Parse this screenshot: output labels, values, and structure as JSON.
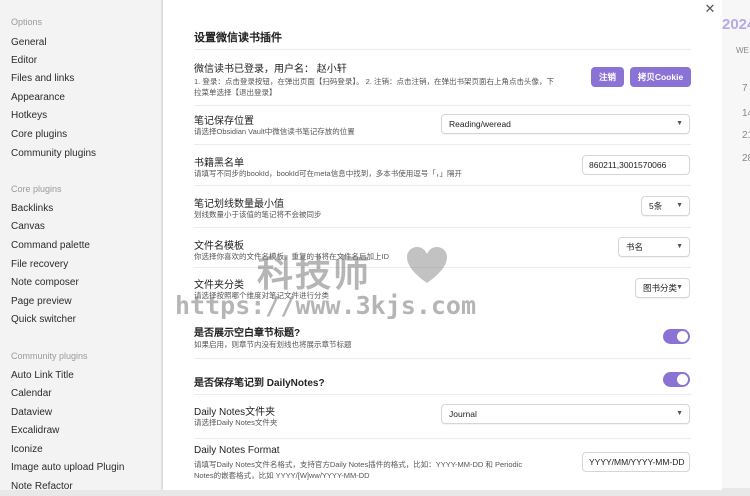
{
  "sidebar": {
    "options_title": "Options",
    "options": [
      "General",
      "Editor",
      "Files and links",
      "Appearance",
      "Hotkeys",
      "Core plugins",
      "Community plugins"
    ],
    "core_title": "Core plugins",
    "core": [
      "Backlinks",
      "Canvas",
      "Command palette",
      "File recovery",
      "Note composer",
      "Page preview",
      "Quick switcher"
    ],
    "community_title": "Community plugins",
    "community": [
      "Auto Link Title",
      "Calendar",
      "Dataview",
      "Excalidraw",
      "Iconize",
      "Image auto upload Plugin",
      "Note Refactor"
    ]
  },
  "main": {
    "close_icon": "✕",
    "title": "设置微信读书插件",
    "login": {
      "name": "微信读书已登录，用户名：  赵小轩",
      "desc1": "1. 登录：点击登录按钮，在弹出页面【扫码登录】。 2. 注销：点击注销，在弹出书架页面右上角点击头像，下",
      "desc2": "拉菜单选择【退出登录】",
      "logout_label": "注销",
      "copy_cookie_label": "拷贝Cookie"
    },
    "save_location": {
      "name": "笔记保存位置",
      "desc": "请选择Obsidian Vault中微信读书笔记存放的位置",
      "value": "Reading/weread"
    },
    "blacklist": {
      "name": "书籍黑名单",
      "desc": "请填写不同步的bookId，bookId可在meta信息中找到，多本书使用逗号「，」隔开",
      "value": "860211,3001570066"
    },
    "min_highlights": {
      "name": "笔记划线数量最小值",
      "desc": "划线数量小于该值的笔记将不会被同步",
      "value": "5条"
    },
    "filename_template": {
      "name": "文件名模板",
      "desc": "你选择你喜欢的文件名模板，重复的书将在文件名后加上ID",
      "value": "书名"
    },
    "folder_category": {
      "name": "文件夹分类",
      "desc": "请选择按照哪个维度对笔记文件进行分类",
      "value": "图书分类"
    },
    "empty_chapter": {
      "name": "是否展示空白章节标题?",
      "desc": "如果启用，则章节内没有划线也将展示章节标题"
    },
    "daily_notes": {
      "name": "是否保存笔记到 DailyNotes?"
    },
    "daily_folder": {
      "name": "Daily Notes文件夹",
      "desc": "请选择Daily Notes文件夹",
      "value": "Journal"
    },
    "daily_format": {
      "name": "Daily Notes Format",
      "desc1": "请填写Daily Notes文件名格式，支持官方Daily Notes插件的格式，比如：YYYY-MM-DD 和 Periodic",
      "desc2": "Notes的嵌套格式，比如 YYYY/[W]ww/YYYY-MM-DD",
      "value": "YYYY/MM/YYYY-MM-DD"
    }
  },
  "calendar": {
    "year": "2024",
    "weekday": "WE",
    "days": [
      "7",
      "14",
      "21",
      "28"
    ]
  },
  "watermark": {
    "cn": "科技师",
    "url": "https://www.3kjs.com"
  },
  "colors": {
    "accent": "#8b73d6"
  }
}
